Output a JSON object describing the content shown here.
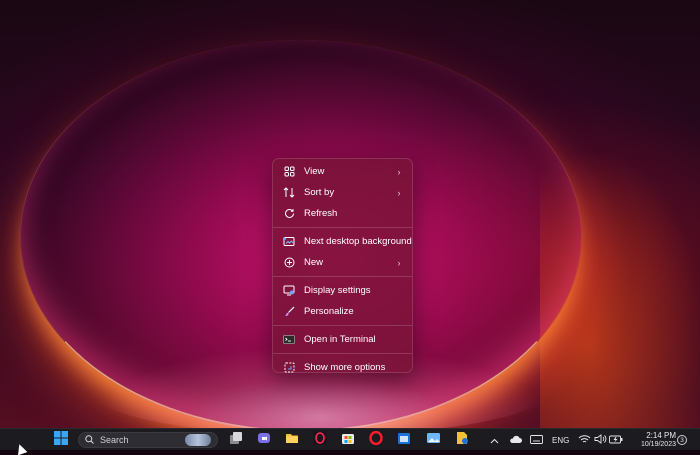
{
  "desktop": {
    "wallpaper": "Windows 11 bloom wallpaper",
    "accent_colors": [
      "#d6157a",
      "#ff6a1f",
      "#1a0713"
    ]
  },
  "context_menu": {
    "items": [
      {
        "label": "View",
        "icon": "grid-icon",
        "submenu": true
      },
      {
        "label": "Sort by",
        "icon": "sort-arrows-icon",
        "submenu": true
      },
      {
        "label": "Refresh",
        "icon": "refresh-icon",
        "submenu": false
      },
      {
        "label": "Next desktop background",
        "icon": "next-background-icon",
        "submenu": false
      },
      {
        "label": "New",
        "icon": "plus-circle-icon",
        "submenu": true
      },
      {
        "label": "Display settings",
        "icon": "display-icon",
        "submenu": false
      },
      {
        "label": "Personalize",
        "icon": "brush-icon",
        "submenu": false
      },
      {
        "label": "Open in Terminal",
        "icon": "terminal-icon",
        "submenu": false
      },
      {
        "label": "Show more options",
        "icon": "more-options-icon",
        "submenu": false
      }
    ]
  },
  "taskbar": {
    "search_placeholder": "Search",
    "apps": [
      "task-view",
      "teams-chat",
      "file-explorer",
      "opera-gx",
      "microsoft-store",
      "opera",
      "outlook-calendar",
      "photos",
      "app"
    ],
    "tray": {
      "language": "ENG",
      "time": "2:14 PM",
      "date": "10/19/2023",
      "notifications_count": "3"
    }
  }
}
